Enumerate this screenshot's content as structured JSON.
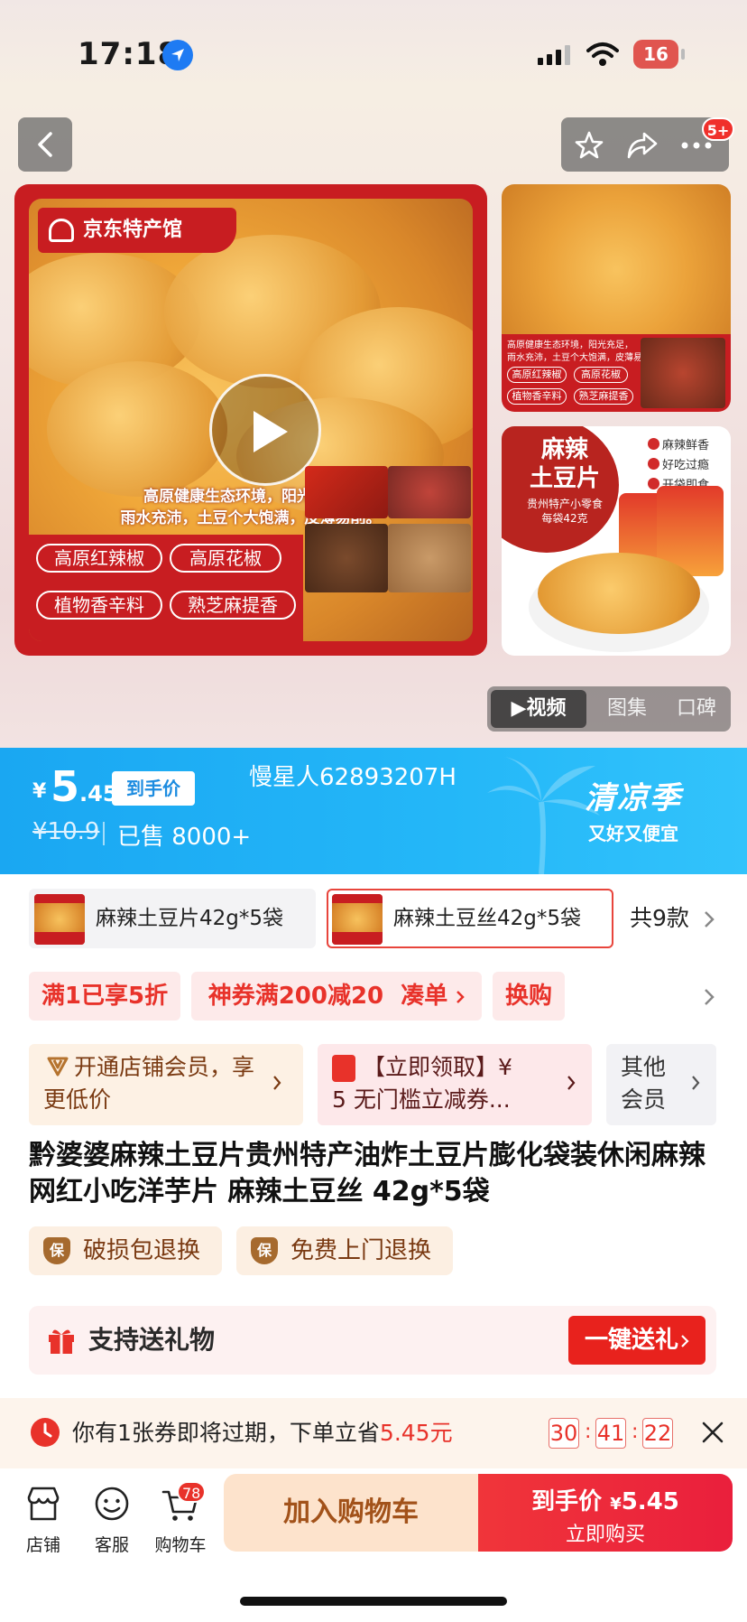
{
  "status": {
    "time": "17:18",
    "battery": "16"
  },
  "nav": {
    "badge": "5+"
  },
  "gallery": {
    "brand": "京东特产馆",
    "description_line1": "高原健康生态环境，阳光充足，",
    "description_line2": "雨水充沛，土豆个大饱满，皮薄易削。",
    "tags": [
      "高原红辣椒",
      "高原花椒",
      "植物香辛料",
      "熟芝麻提香"
    ],
    "side1_line1": "高原健康生态环境，阳光充足，",
    "side1_line2": "雨水充沛，土豆个大饱满，皮薄易削。",
    "side1_tags": [
      "高原红辣椒",
      "高原花椒",
      "植物香辛料",
      "熟芝麻提香"
    ],
    "side2_title1": "麻辣",
    "side2_title2": "土豆片",
    "side2_sub1": "贵州特产小零食",
    "side2_sub2": "每袋42克",
    "side2_checks": [
      "麻辣鲜香",
      "好吃过瘾",
      "开袋即食"
    ],
    "segments": [
      "▶视频",
      "图集",
      "口碑"
    ]
  },
  "price": {
    "currency": "¥",
    "integer": "5",
    "decimal": ".45",
    "tag": "到手价",
    "original": "¥10.9",
    "sold": "已售 8000+",
    "username": "慢星人62893207H",
    "season_title": "清凉季",
    "season_sub": "又好又便宜"
  },
  "sku": {
    "option1": "麻辣土豆片42g*5袋",
    "option2": "麻辣土豆丝42g*5袋",
    "more": "共9款"
  },
  "promos": [
    "满1已享5折",
    "神券满200减20",
    "凑单",
    "换购"
  ],
  "cards": {
    "member": "开通店铺会员，享更低价",
    "coupon_line1": "【立即领取】¥",
    "coupon_line2": "5 无门槛立减券...",
    "other_line1": "其他",
    "other_line2": "会员"
  },
  "product_title": "黔婆婆麻辣土豆片贵州特产油炸土豆片膨化袋装休闲麻辣网红小吃洋芋片 麻辣土豆丝 42g*5袋",
  "guarantees": [
    {
      "icon_text": "保",
      "label": "破损包退换"
    },
    {
      "icon_text": "保",
      "label": "免费上门退换"
    }
  ],
  "gift": {
    "label": "支持送礼物",
    "button": "一键送礼"
  },
  "notice": {
    "text_prefix": "你有1张券即将过期，下单立省",
    "amount": "5.45元",
    "countdown": [
      "30",
      "41",
      "22"
    ]
  },
  "bottom": {
    "tabs": [
      "店铺",
      "客服",
      "购物车"
    ],
    "cart_count": "78",
    "add_to_cart": "加入购物车",
    "buy_line1_prefix": "到手价",
    "buy_price_yen": "¥",
    "buy_price": "5.45",
    "buy_line2": "立即购买"
  },
  "colors": {
    "brand_red": "#c81d21",
    "banner_blue": "#24b7f8",
    "action_red": "#e8322a",
    "cart_bg": "#fde3cc"
  },
  "icons": [
    "location-arrow-icon",
    "signal-icon",
    "wifi-icon",
    "back-icon",
    "star-icon",
    "share-icon",
    "more-icon",
    "play-icon",
    "chevron-right-icon",
    "gift-icon",
    "clock-icon",
    "close-icon",
    "store-icon",
    "service-icon",
    "cart-icon"
  ]
}
